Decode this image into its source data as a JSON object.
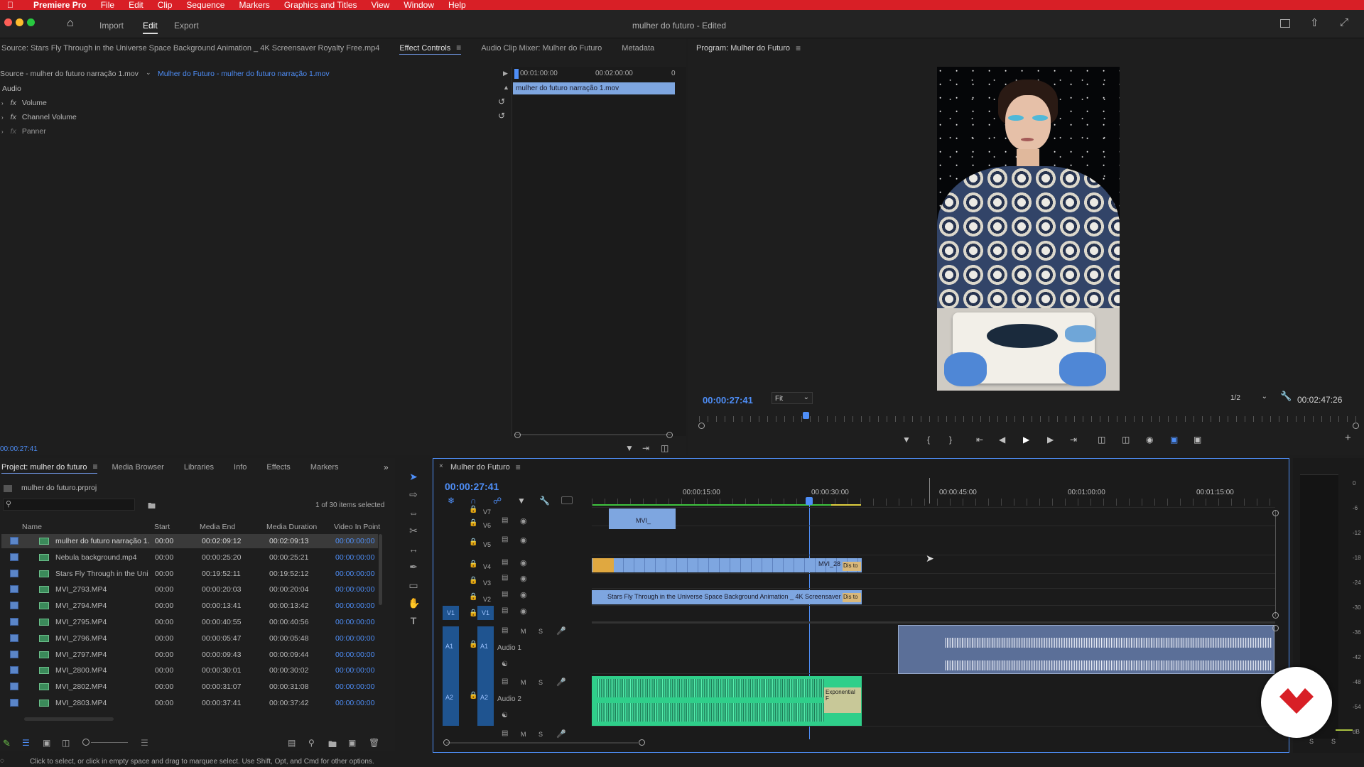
{
  "menubar": {
    "app": "Premiere Pro",
    "items": [
      "File",
      "Edit",
      "Clip",
      "Sequence",
      "Markers",
      "Graphics and Titles",
      "View",
      "Window",
      "Help"
    ]
  },
  "titlebar": {
    "tabs": [
      "Import",
      "Edit",
      "Export"
    ],
    "title": "mulher do futuro",
    "status": "- Edited"
  },
  "source_panel": {
    "tabs": [
      "Source: Stars Fly Through in the Universe Space Background Animation _ 4K Screensaver Royalty Free.mp4",
      "Effect Controls",
      "Audio Clip Mixer: Mulher do Futuro",
      "Metadata"
    ],
    "clip_source": "Source - mulher do futuro narração 1.mov",
    "clip_seq": "Mulher do Futuro - mulher do futuro narração 1.mov",
    "section": "Audio",
    "effects": [
      "Volume",
      "Channel Volume",
      "Panner"
    ],
    "ruler": [
      "00:01:00:00",
      "00:02:00:00",
      "0"
    ],
    "clip_name": "mulher do futuro narração 1.mov",
    "timecode": "00:00:27:41"
  },
  "program": {
    "tab": "Program: Mulher do Futuro",
    "timecode": "00:00:27:41",
    "fit": "Fit",
    "resolution": "1/2",
    "duration": "00:02:47:26"
  },
  "project": {
    "tabs": [
      "Project: mulher do futuro",
      "Media Browser",
      "Libraries",
      "Info",
      "Effects",
      "Markers"
    ],
    "file": "mulher do futuro.prproj",
    "selection": "1 of 30 items selected",
    "columns": [
      "Name",
      "Start",
      "Media End",
      "Media Duration",
      "Video In Point"
    ],
    "rows": [
      [
        "mulher do futuro narração 1.",
        "00:00",
        "00:02:09:12",
        "00:02:09:13",
        "00:00:00:00"
      ],
      [
        "Nebula background.mp4",
        "00:00",
        "00:00:25:20",
        "00:00:25:21",
        "00:00:00:00"
      ],
      [
        "Stars Fly Through in the Uni",
        "00:00",
        "00:19:52:11",
        "00:19:52:12",
        "00:00:00:00"
      ],
      [
        "MVI_2793.MP4",
        "00:00",
        "00:00:20:03",
        "00:00:20:04",
        "00:00:00:00"
      ],
      [
        "MVI_2794.MP4",
        "00:00",
        "00:00:13:41",
        "00:00:13:42",
        "00:00:00:00"
      ],
      [
        "MVI_2795.MP4",
        "00:00",
        "00:00:40:55",
        "00:00:40:56",
        "00:00:00:00"
      ],
      [
        "MVI_2796.MP4",
        "00:00",
        "00:00:05:47",
        "00:00:05:48",
        "00:00:00:00"
      ],
      [
        "MVI_2797.MP4",
        "00:00",
        "00:00:09:43",
        "00:00:09:44",
        "00:00:00:00"
      ],
      [
        "MVI_2800.MP4",
        "00:00",
        "00:00:30:01",
        "00:00:30:02",
        "00:00:00:00"
      ],
      [
        "MVI_2802.MP4",
        "00:00",
        "00:00:31:07",
        "00:00:31:08",
        "00:00:00:00"
      ],
      [
        "MVI_2803.MP4",
        "00:00",
        "00:00:37:41",
        "00:00:37:42",
        "00:00:00:00"
      ]
    ]
  },
  "timeline": {
    "tab": "Mulher do Futuro",
    "timecode": "00:00:27:41",
    "ruler": [
      "00:00:15:00",
      "00:00:30:00",
      "00:00:45:00",
      "00:01:00:00",
      "00:01:15:00"
    ],
    "tracks": [
      "V7",
      "V6",
      "V5",
      "V4",
      "V3",
      "V2",
      "V1",
      "A1",
      "A2"
    ],
    "src_patch": [
      "V1",
      "A1",
      "A2"
    ],
    "audio_names": [
      "Audio 1",
      "Audio 2"
    ],
    "clips": {
      "v6": "MVI_",
      "v4": "MVI_28",
      "v4b": "Dis to",
      "v2": "Stars Fly Through in the Universe Space Background Animation _ 4K Screensaver R",
      "v2b": "Dis to",
      "a2": "Exponential F"
    }
  },
  "meter": {
    "labels": [
      "0",
      "-6",
      "-12",
      "-18",
      "-24",
      "-30",
      "-36",
      "-42",
      "-48",
      "-54",
      "dB"
    ],
    "solo": [
      "S",
      "S"
    ]
  },
  "statusbar": "Click to select, or click in empty space and drag to marquee select. Use Shift, Opt, and Cmd for other options.",
  "colors": {
    "accent": "#4e8ef7",
    "menubar": "#d81f26",
    "audio_clip": "#3ed89a",
    "video_clip": "#7ea6e0"
  }
}
